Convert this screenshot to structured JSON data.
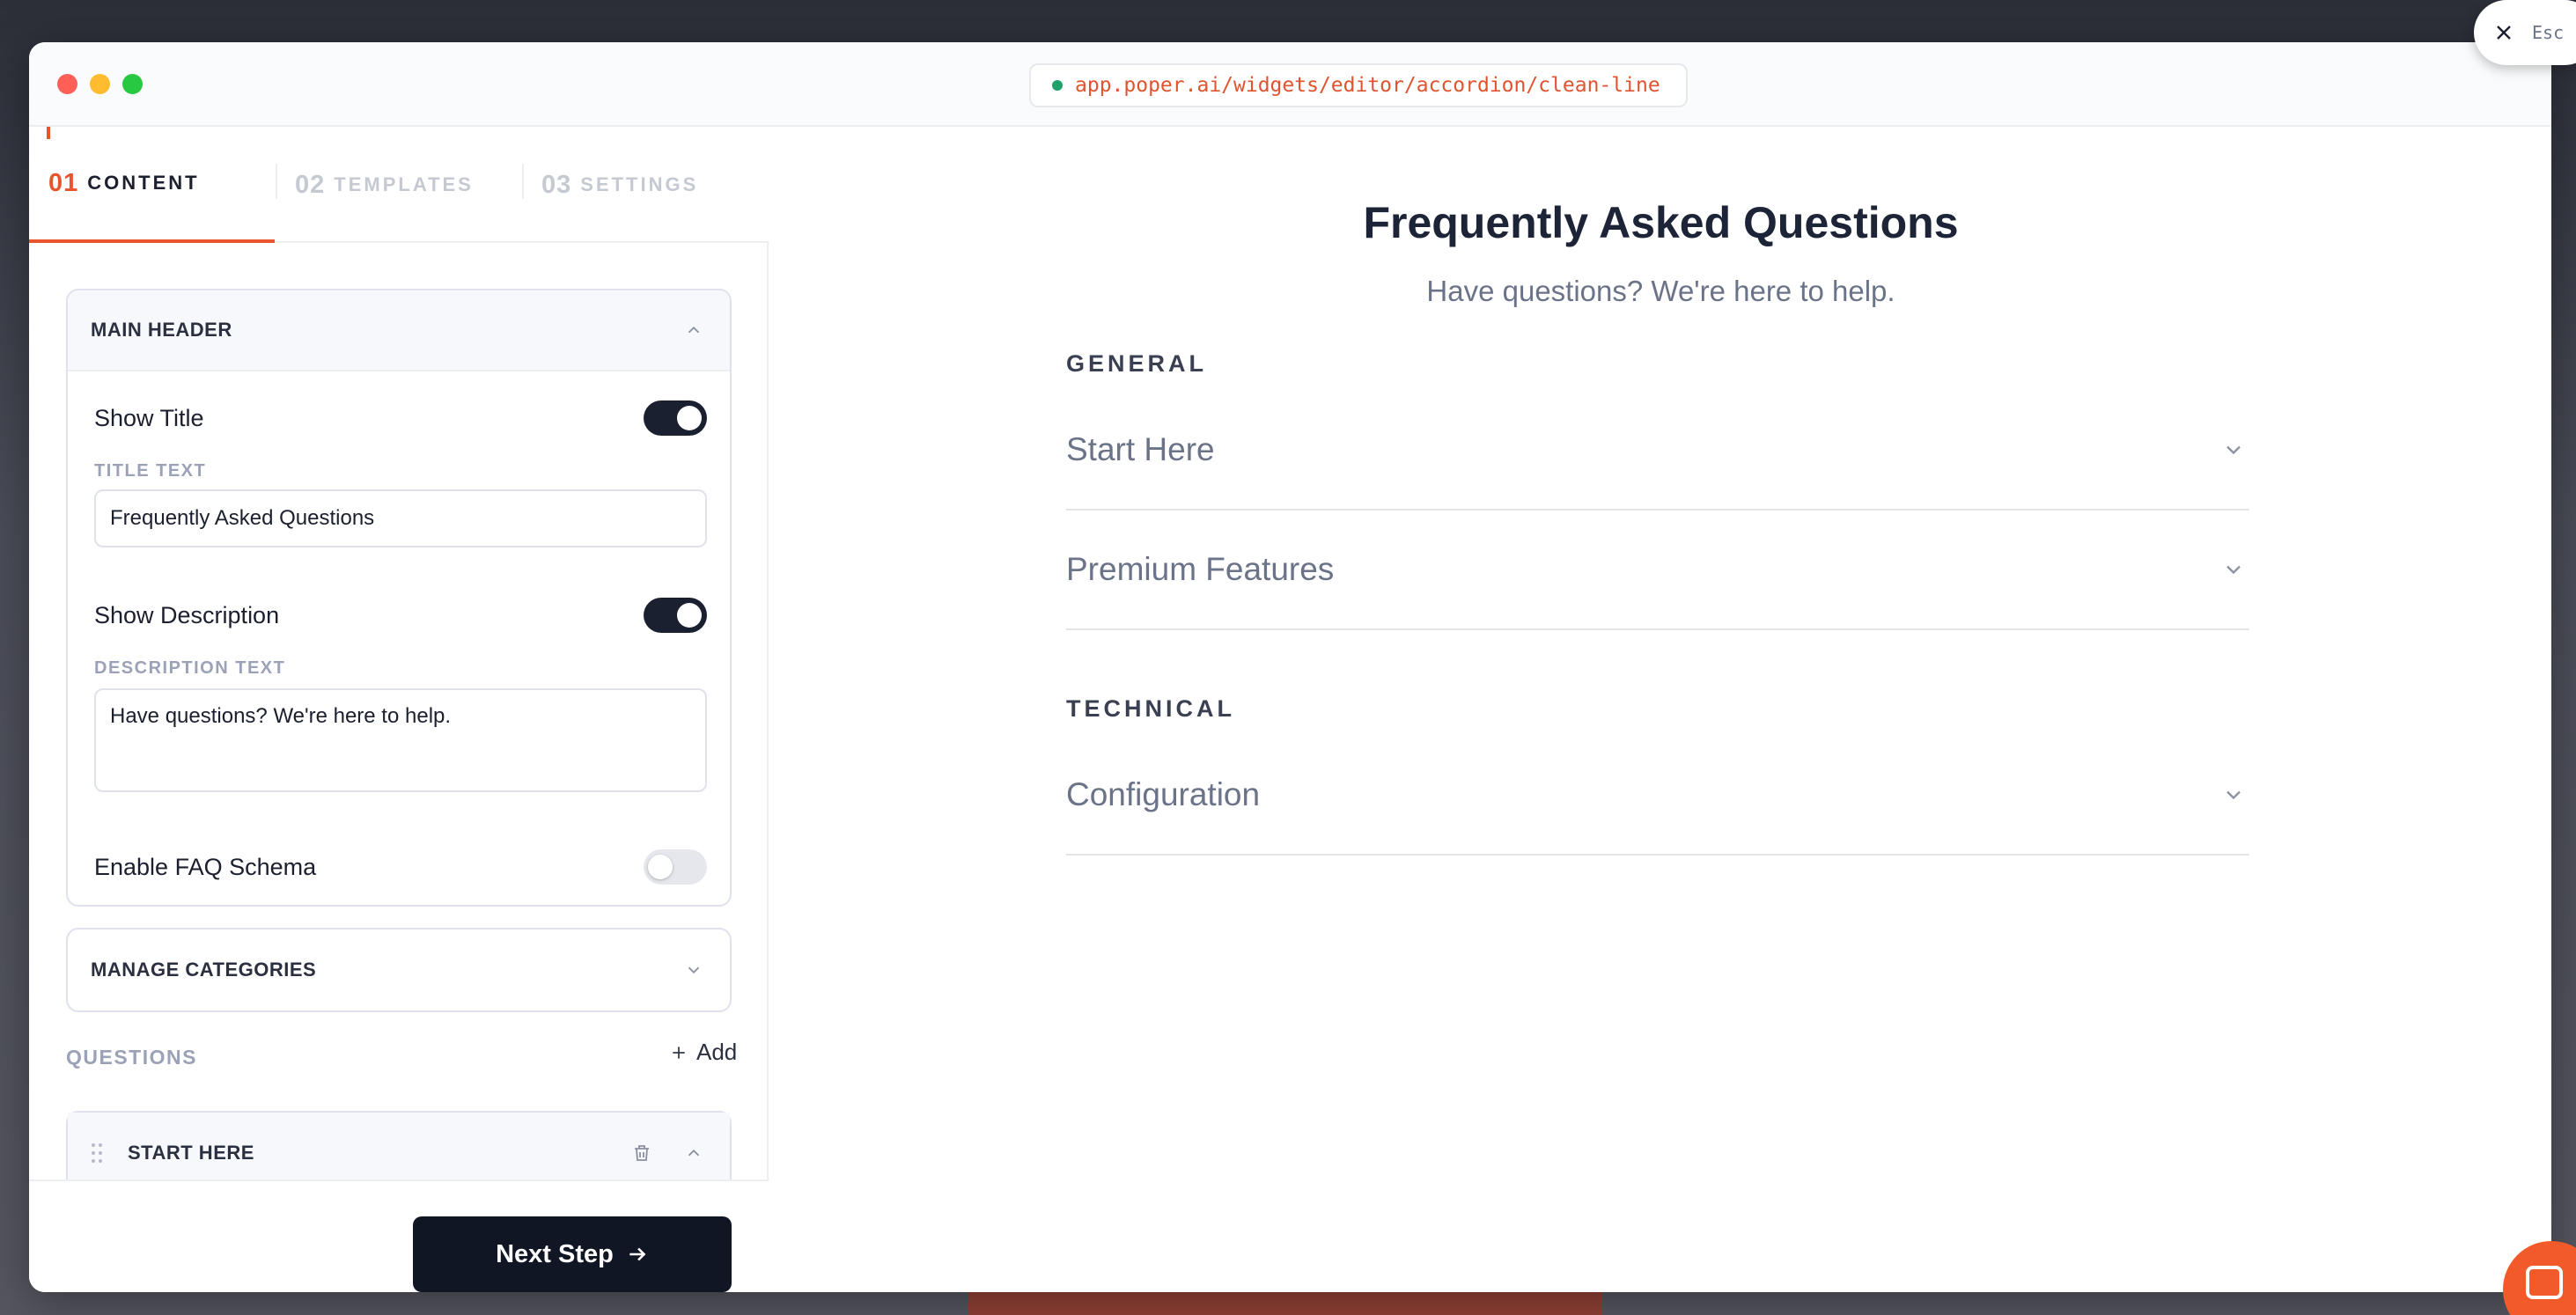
{
  "browser": {
    "url": "app.poper.ai/widgets/editor/accordion/clean-line"
  },
  "overlay": {
    "close_hint": "Esc"
  },
  "steps": [
    {
      "num": "01",
      "label": "CONTENT",
      "active": true
    },
    {
      "num": "02",
      "label": "TEMPLATES",
      "active": false
    },
    {
      "num": "03",
      "label": "SETTINGS",
      "active": false
    }
  ],
  "main_header": {
    "section_title": "MAIN HEADER",
    "show_title_label": "Show Title",
    "show_title": true,
    "title_text_label": "TITLE TEXT",
    "title_text_value": "Frequently Asked Questions",
    "show_description_label": "Show Description",
    "show_description": true,
    "description_text_label": "DESCRIPTION TEXT",
    "description_text_value": "Have questions? We're here to help.",
    "faq_schema_label": "Enable FAQ Schema",
    "faq_schema": false
  },
  "manage_categories": {
    "section_title": "MANAGE CATEGORIES"
  },
  "questions": {
    "label": "QUESTIONS",
    "add_label": "Add",
    "items": [
      {
        "title": "START HERE"
      }
    ]
  },
  "footer": {
    "next_label": "Next Step"
  },
  "preview": {
    "title": "Frequently Asked Questions",
    "description": "Have questions? We're here to help.",
    "categories": [
      {
        "name": "GENERAL",
        "items": [
          "Start Here",
          "Premium Features"
        ]
      },
      {
        "name": "TECHNICAL",
        "items": [
          "Configuration"
        ]
      }
    ]
  },
  "colors": {
    "accent": "#e9542c",
    "primary_dark": "#111624",
    "url_text": "#e0532f"
  }
}
